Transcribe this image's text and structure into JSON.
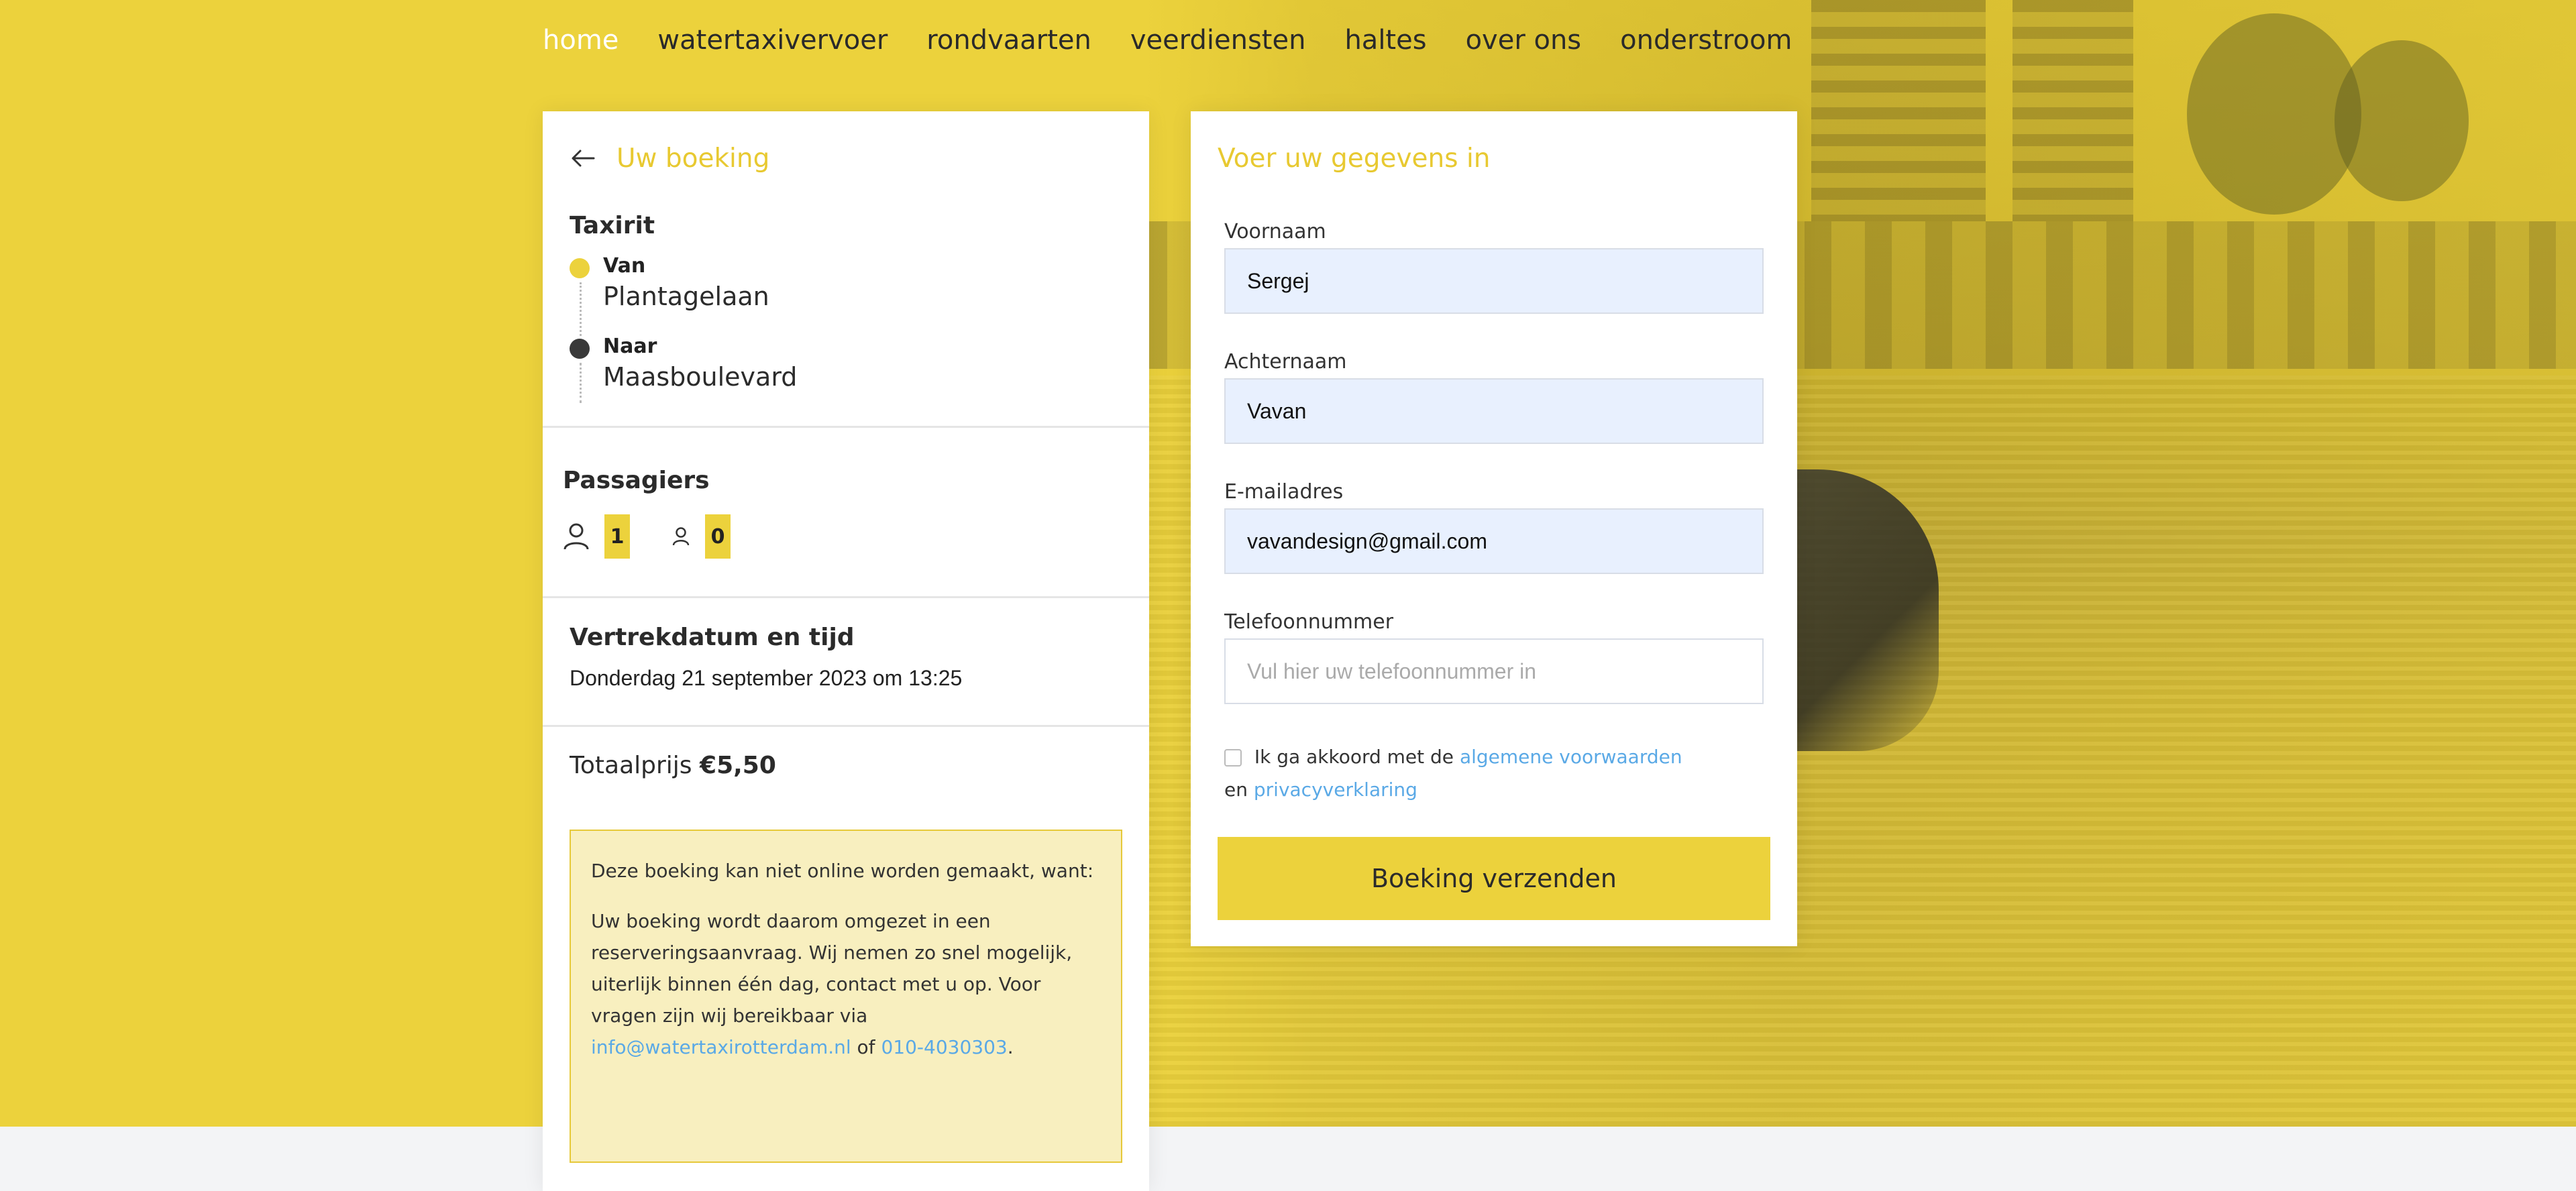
{
  "nav": {
    "items": [
      "home",
      "watertaxivervoer",
      "rondvaarten",
      "veerdiensten",
      "haltes",
      "over ons",
      "onderstroom"
    ],
    "active": "home"
  },
  "booking": {
    "back_icon": "arrow-left-icon",
    "title": "Uw boeking",
    "trip": {
      "title": "Taxirit",
      "from_label": "Van",
      "from_value": "Plantagelaan",
      "to_label": "Naar",
      "to_value": "Maasboulevard"
    },
    "passengers": {
      "title": "Passagiers",
      "adult_icon": "adult-person-icon",
      "adults": "1",
      "child_icon": "child-person-icon",
      "children": "0"
    },
    "departure": {
      "title": "Vertrekdatum en tijd",
      "value": "Donderdag 21 september 2023 om 13:25"
    },
    "total": {
      "label": "Totaalprijs",
      "value": "€5,50"
    },
    "notice": {
      "line1": "Deze boeking kan niet online worden gemaakt, want:",
      "line2_text": "Uw boeking wordt daarom omgezet in een reserveringsaanvraag. Wij nemen zo snel mogelijk, uiterlijk binnen één dag, contact met u op. Voor vragen zijn wij bereikbaar via",
      "email": "info@watertaxirotterdam.nl",
      "or": "of",
      "phone": "010-4030303",
      "end": "."
    }
  },
  "form": {
    "title": "Voer uw gegevens in",
    "first_name": {
      "label": "Voornaam",
      "value": "Sergej"
    },
    "last_name": {
      "label": "Achternaam",
      "value": "Vavan"
    },
    "email": {
      "label": "E-mailadres",
      "value": "vavandesign@gmail.com"
    },
    "phone": {
      "label": "Telefoonnummer",
      "placeholder": "Vul hier uw telefoonnummer in"
    },
    "consent": {
      "text_before": "Ik ga akkoord met de",
      "terms_link": "algemene voorwaarden",
      "and": "en",
      "privacy_link": "privacyverklaring",
      "checked": false
    },
    "submit_label": "Boeking verzenden"
  },
  "colors": {
    "brand_yellow": "#ecd23c",
    "link_blue": "#5aa9e6",
    "autofill_blue": "#e8f0fe",
    "notice_bg": "#f8efbf"
  }
}
